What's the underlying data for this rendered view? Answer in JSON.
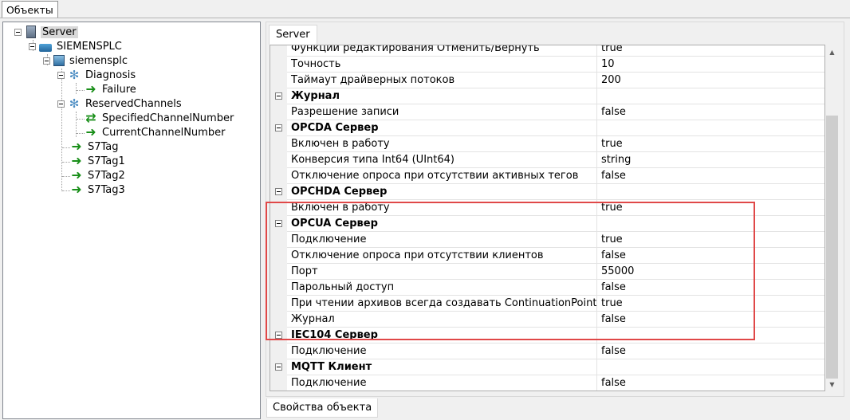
{
  "top_tab": "Объекты",
  "tree": {
    "root": "Server",
    "plc": "SIEMENSPLC",
    "device": "siemensplc",
    "diagnosis": "Diagnosis",
    "failure": "Failure",
    "reserved": "ReservedChannels",
    "specified": "SpecifiedChannelNumber",
    "current": "CurrentChannelNumber",
    "tag0": "S7Tag",
    "tag1": "S7Tag1",
    "tag2": "S7Tag2",
    "tag3": "S7Tag3"
  },
  "right_tab": "Server",
  "bottom_tab": "Свойства объекта",
  "grid": {
    "rows": [
      {
        "name": "Функции редактирования Отменить/Вернуть",
        "value": "true"
      },
      {
        "name": "Точность",
        "value": "10"
      },
      {
        "name": "Таймаут драйверных потоков",
        "value": "200"
      },
      {
        "name": "Журнал",
        "value": ""
      },
      {
        "name": "Разрешение записи",
        "value": "false"
      },
      {
        "name": "OPCDA Сервер",
        "value": ""
      },
      {
        "name": "Включен в работу",
        "value": "true"
      },
      {
        "name": "Конверсия типа Int64 (UInt64)",
        "value": "string"
      },
      {
        "name": "Отключение опроса при отсутствии активных тегов",
        "value": "false"
      },
      {
        "name": "OPCHDA  Сервер",
        "value": ""
      },
      {
        "name": "Включен в работу",
        "value": "true"
      },
      {
        "name": "OPCUA Сервер",
        "value": ""
      },
      {
        "name": "Подключение",
        "value": "true"
      },
      {
        "name": "Отключение опроса при отсутствии клиентов",
        "value": "false"
      },
      {
        "name": "Порт",
        "value": "55000"
      },
      {
        "name": "Парольный доступ",
        "value": "false"
      },
      {
        "name": "При чтении архивов всегда создавать ContinuationPoint",
        "value": "true"
      },
      {
        "name": "Журнал",
        "value": "false"
      },
      {
        "name": "IEC104 Сервер",
        "value": ""
      },
      {
        "name": "Подключение",
        "value": "false"
      },
      {
        "name": "MQTT Клиент",
        "value": ""
      },
      {
        "name": "Подключение",
        "value": "false"
      }
    ]
  },
  "colors": {
    "highlight": "#e04848",
    "selection": "#d9d9d9",
    "arrow_icon": "#1a8f1a"
  }
}
